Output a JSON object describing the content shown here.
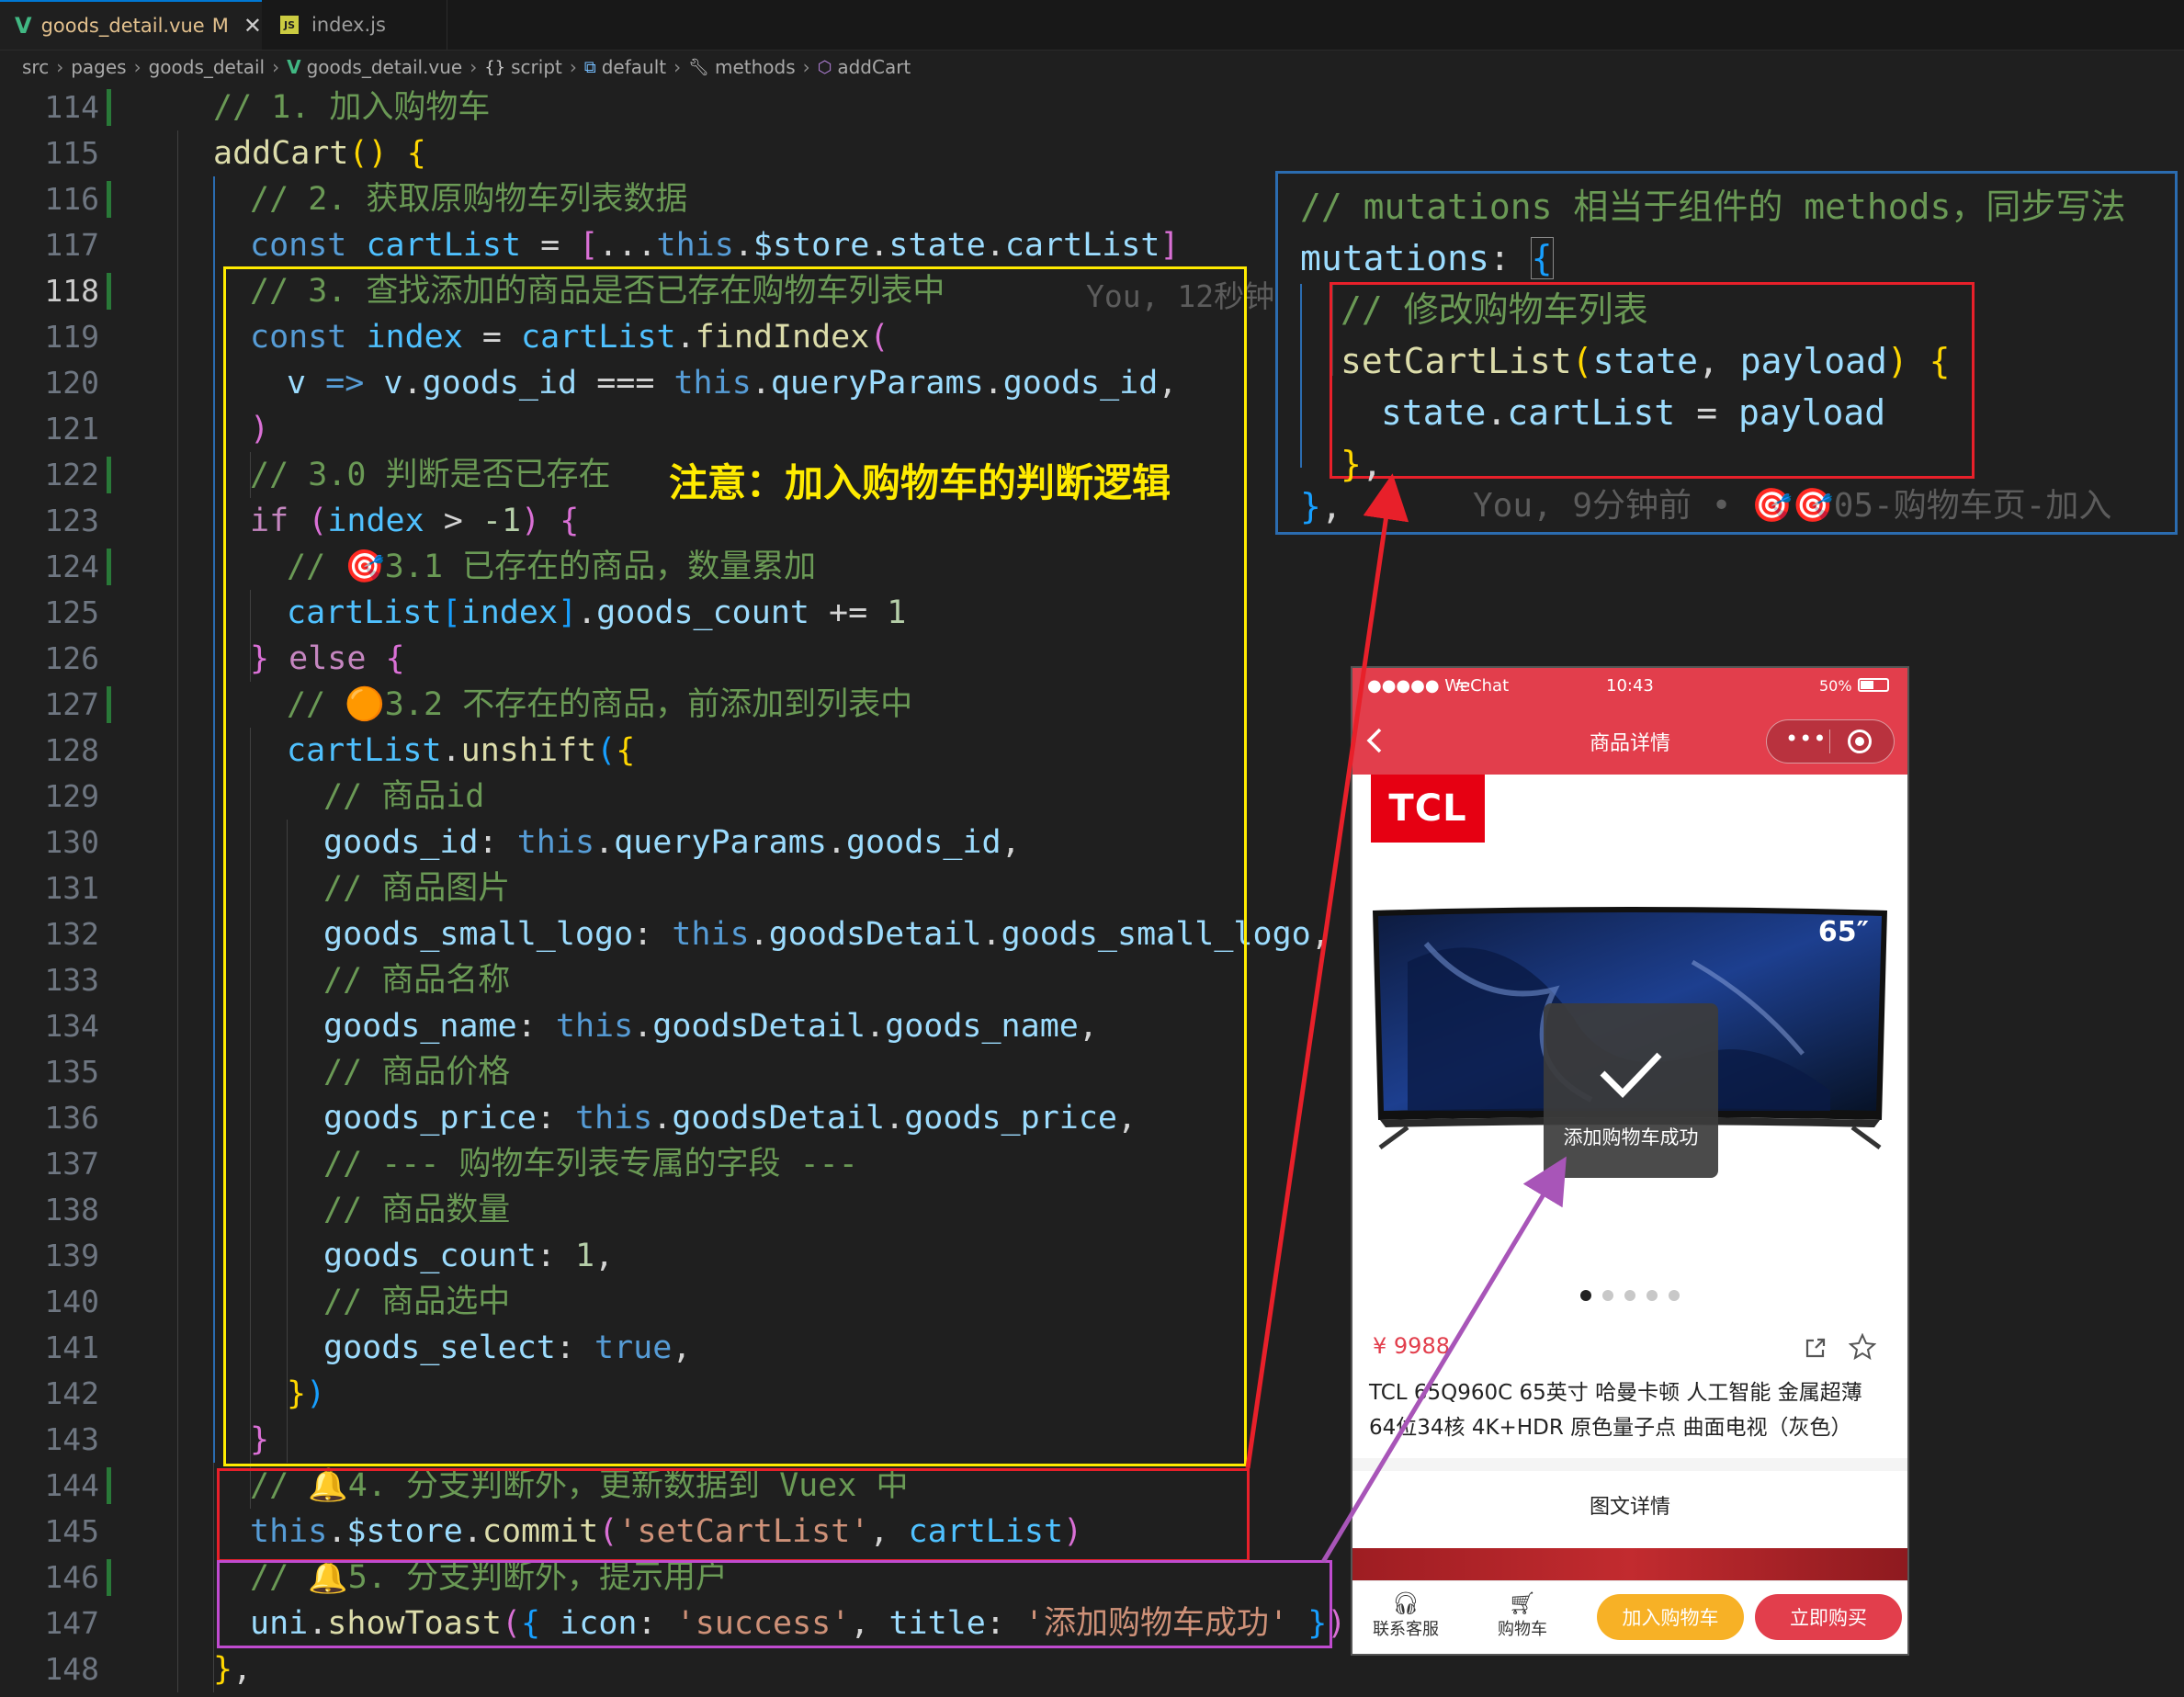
{
  "tabs": [
    {
      "icon": "V",
      "label": "goods_detail.vue",
      "modified": "M",
      "close": "✕"
    },
    {
      "icon": "JS",
      "label": "index.js"
    }
  ],
  "breadcrumb": [
    "src",
    "pages",
    "goods_detail",
    "goods_detail.vue",
    "script",
    "default",
    "methods",
    "addCart"
  ],
  "line_numbers": [
    "114",
    "115",
    "116",
    "117",
    "118",
    "119",
    "120",
    "121",
    "122",
    "123",
    "124",
    "125",
    "126",
    "127",
    "128",
    "129",
    "130",
    "131",
    "132",
    "133",
    "134",
    "135",
    "136",
    "137",
    "138",
    "139",
    "140",
    "141",
    "142",
    "143",
    "144",
    "145",
    "146",
    "147",
    "148"
  ],
  "annotation_note": "注意：加入购物车的判断逻辑",
  "blame_inline_118": "You, 12秒钟",
  "mutations_panel": {
    "comment": "// mutations 相当于组件的 methods，同步写法",
    "blame": "You, 9分钟前 • 🎯🎯05-购物车页-加入"
  },
  "phone": {
    "carrier": "●●●●● WeChat",
    "time": "10:43",
    "battery": "50%",
    "nav_title": "商品详情",
    "brand_logo": "TCL",
    "screen_size_badge": "65″",
    "toast_text": "添加购物车成功",
    "price": "¥ 9988",
    "goods_name": "TCL 65Q960C 65英寸 哈曼卡顿 人工智能 金属超薄 64位34核 4K+HDR 原色量子点 曲面电视（灰色）",
    "detail_title": "图文详情",
    "swiper_dots": 5,
    "swiper_active": 0,
    "bottom_bar": {
      "service": "联系客服",
      "cart": "购物车",
      "add_cart": "加入购物车",
      "buy_now": "立即购买"
    }
  },
  "colors": {
    "editor_bg": "#1f1f1f",
    "yellow_box": "#ffeb00",
    "red_box": "#e8202a",
    "magenta_box": "#c04bd0",
    "blue_box": "#2b6cb0",
    "phone_red": "#e23e4c",
    "add_cart_btn": "#f7b126",
    "buy_btn": "#e23e4c"
  }
}
